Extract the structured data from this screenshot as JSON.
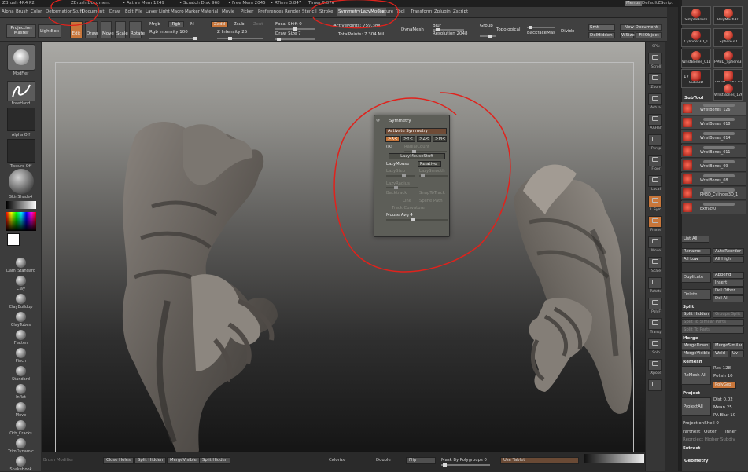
{
  "titlebar": {
    "app": "ZBrush 4R4 P2",
    "document": "ZBrush Document",
    "active_mem": "• Active Mem 1249",
    "scratch_disk": "• Scratch Disk 968",
    "free_mem": "• Free Mem 2045",
    "rtime": "• RTime 3.847",
    "timer": "Timer 0.076",
    "menus": "Menus",
    "script": "DefaultZScript"
  },
  "menubar": [
    "Alpha",
    "Brush",
    "Color",
    "DeformationStuff",
    "Document",
    "Draw",
    "Edit",
    "File",
    "Layer",
    "Light",
    "Macro",
    "Marker",
    "Material",
    "Movie",
    "Picker",
    "Preferences",
    "Render",
    "Stencil",
    "Stroke",
    "SymmetryLazyMouse",
    "Texture",
    "Tool",
    "Transform",
    "Zplugin",
    "Zscript"
  ],
  "topbar": {
    "projection_master": "Projection Master",
    "lightbox": "LightBox",
    "edit": "Edit",
    "draw": "Draw",
    "move": "Move",
    "scale": "Scale",
    "rotate": "Rotate",
    "mrgb": "Mrgb",
    "rgb": "Rgb",
    "m": "M",
    "rgb_intensity_label": "Rgb Intensity",
    "rgb_intensity": "100",
    "zadd": "Zadd",
    "zsub": "Zsub",
    "zcut": "Zcut",
    "z_intensity_label": "Z Intensity",
    "z_intensity": "25",
    "focal_shift_label": "Focal Shift",
    "focal_shift": "0",
    "draw_size_label": "Draw Size",
    "draw_size": "7",
    "active_points": "ActivePoints: 759,384",
    "total_points": "TotalPoints: 7.304 Mil",
    "dynamesh": "DynaMesh",
    "blur": "Blur",
    "resolution_label": "Resolution",
    "resolution": "2048",
    "group": "Group",
    "topological": "Topological",
    "backface": "BackfaceMas",
    "divide": "Divide",
    "smt": "Smt",
    "delhidden": "DelHidden",
    "new_document": "New Document",
    "wsize": "WSize",
    "fill_object": "FillObject"
  },
  "leftpanel": {
    "modifier": "ModFier",
    "freehand": "FreeHand",
    "alpha_off": "Alpha Off",
    "texture_off": "Texture Off",
    "material": "SkinShade4",
    "brushes": [
      "Dam_Standard",
      "Clay",
      "ClayBuildup",
      "ClayTubes",
      "Flatten",
      "Pinch",
      "Standard",
      "Inflat",
      "Move",
      "Orb_Cracks",
      "TrimDynamic",
      "SnakeHook"
    ]
  },
  "symmetry": {
    "title": "Symmetry",
    "activate": "Activate Symmetry",
    "axes": [
      ">X<",
      ">Y<",
      ">Z<",
      ">M<"
    ],
    "r": "(R)",
    "radialcount": "RadialCount",
    "lazy_stuff": "LazyMouseStuff",
    "lazymouse": "LazyMouse",
    "relative": "Relative",
    "lazystep": "LazyStep",
    "lazysmooth": "LazySmooth",
    "lazyradius": "LazyRadius",
    "backtrack": "Backtrack",
    "snapback": "SnapToTrack",
    "line": "Line",
    "spline": "Spline Path",
    "track_curvature": "Track Curvature",
    "mouse_avg_label": "Mouse Avg",
    "mouse_avg": "4"
  },
  "bottombar": {
    "brush_modifier": "Brush Modifier",
    "close_holes": "Close Holes",
    "split_hidden": "Split Hidden",
    "merge_visible": "MergeVisible",
    "split_hidden2": "Split Hidden",
    "colorize": "Colorize",
    "double": "Double",
    "flip": "Flip",
    "mask_by_polygroups_label": "Mask By Polygroups",
    "mask_by_polygroups": "0",
    "use_tablet": "Use Tablet"
  },
  "rightshelf": [
    "SPix",
    "Scroll",
    "Zoom",
    "Actual",
    "AAHalf",
    "Persp",
    "Floor",
    "Local",
    "L.Sym",
    "Frame",
    "Move",
    "Scale",
    "Rotate",
    "PolyF",
    "Transp",
    "Solo",
    "Xpose"
  ],
  "tray": {
    "tools": [
      "SimpleBrush",
      "PolyMesh3D",
      "Cylinder3D_1",
      "Sphere3D",
      "WristBones_011",
      "PM3D_Sphere3D",
      "Cube3D",
      "PM3D_Cube3D",
      "WristBones_126"
    ],
    "tool_count": "17",
    "subtool_title": "SubTool",
    "subtools": [
      "WristBones_126",
      "WristBones_018",
      "WristBones_014",
      "WristBones_011",
      "WristBones_09",
      "WristBones_08",
      "PM3D_Cylinder3D_1",
      "Extract0"
    ],
    "list_all": "List All",
    "rename": "Rename",
    "autoreorder": "AutoReorder",
    "all_low": "All Low",
    "all_high": "All High",
    "duplicate": "Duplicate",
    "append": "Append",
    "insert": "Insert",
    "delete": "Delete",
    "del_other": "Del Other",
    "del_all": "Del All",
    "split_title": "Split",
    "split_hidden": "Split Hidden",
    "groups_split": "Groups Split",
    "split_similar": "Split To Similar Parts",
    "split_parts": "Split To Parts",
    "merge_title": "Merge",
    "merge_down": "MergeDown",
    "merge_similar": "MergeSimilar",
    "merge_visible": "MergeVisible",
    "weld": "Weld",
    "uv": "Uv",
    "remesh_title": "Remesh",
    "remesh_all": "ReMesh All",
    "res_label": "Res",
    "res": "128",
    "polish_label": "Polish",
    "polish": "10",
    "polygrp": "PolyGrp",
    "project_title": "Project",
    "project_all": "ProjectAll",
    "dist_label": "Dist",
    "dist": "0.02",
    "mean_label": "Mean",
    "mean": "25",
    "pa_blur_label": "PA Blur",
    "pa_blur": "10",
    "projection_shell_label": "ProjectionShell",
    "projection_shell": "0",
    "farthest": "Farthest",
    "outer": "Outer",
    "inner": "Inner",
    "reproject": "Reproject Higher Subdiv",
    "extract_title": "Extract",
    "geometry_title": "Geometry"
  },
  "colors": {
    "annotation": "#e0221c",
    "active_orange": "#c8763a"
  }
}
